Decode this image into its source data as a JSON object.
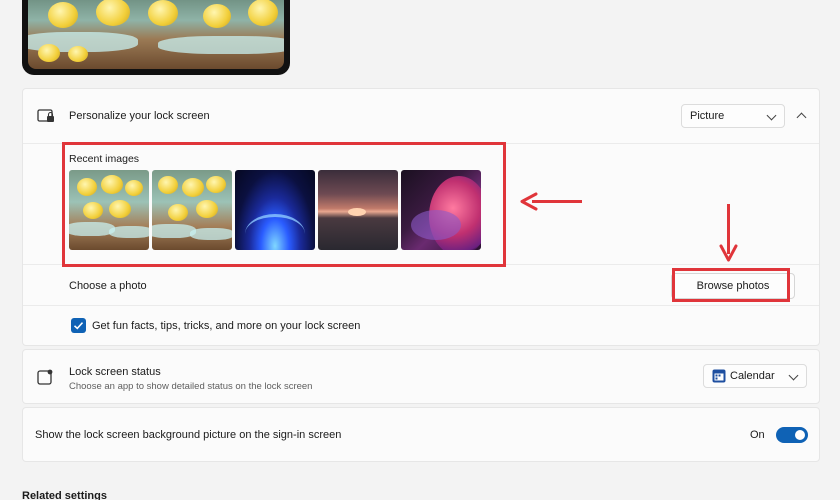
{
  "lock_screen": {
    "title": "Personalize your lock screen",
    "mode_dropdown": {
      "selected": "Picture"
    },
    "recent_images_label": "Recent images",
    "recent_images": [
      "ducks-fountain-1",
      "ducks-fountain-2",
      "blue-bloom",
      "sunset-lake",
      "purple-ribbon"
    ],
    "choose_photo_label": "Choose a photo",
    "browse_button": "Browse photos",
    "fun_facts_label": "Get fun facts, tips, tricks, and more on your lock screen",
    "fun_facts_checked": true
  },
  "lock_status": {
    "title": "Lock screen status",
    "subtitle": "Choose an app to show detailed status on the lock screen",
    "dropdown": {
      "selected": "Calendar"
    }
  },
  "signin": {
    "label": "Show the lock screen background picture on the sign-in screen",
    "toggle_state": "On",
    "toggle_on": true
  },
  "related": {
    "label": "Related settings"
  },
  "colors": {
    "accent": "#0f62b5",
    "annotation": "#e0353a"
  },
  "icons": [
    "lock-screen-icon",
    "status-icon",
    "calendar-icon",
    "chevron-down-icon",
    "chevron-up-icon",
    "checkmark-icon"
  ]
}
